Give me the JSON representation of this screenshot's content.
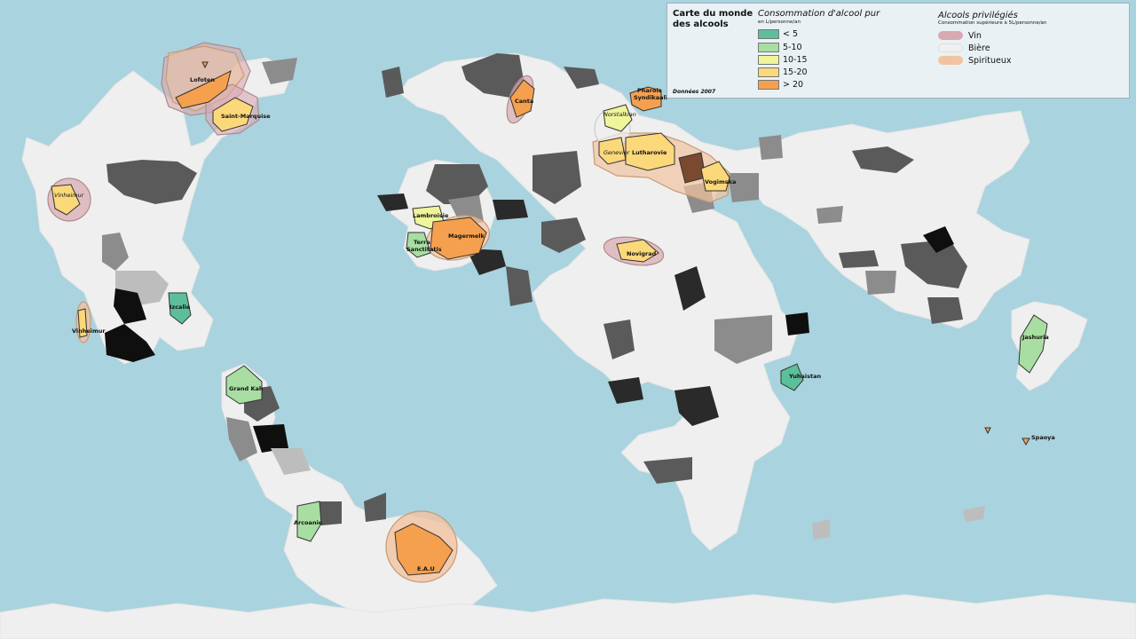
{
  "legend": {
    "title": "Carte du monde des alcools",
    "date": "Données 2007",
    "consumption_title": "Consommation d'alcool pur",
    "consumption_unit": "en L/personne/an",
    "consumption_items": [
      {
        "label": "< 5",
        "color": "#5dbf9a"
      },
      {
        "label": "5-10",
        "color": "#a8dea2"
      },
      {
        "label": "10-15",
        "color": "#eef59a"
      },
      {
        "label": "15-20",
        "color": "#fbd87a"
      },
      {
        "label": "> 20",
        "color": "#f5a04e"
      }
    ],
    "alcohol_title": "Alcools privilégiés",
    "alcohol_sub": "Consommation supérieure à 5L/personne/an",
    "alcohol_items": [
      {
        "label": "Vin",
        "color": "#d9a9b1"
      },
      {
        "label": "Bière",
        "color": "#f0f0f0"
      },
      {
        "label": "Spiritueux",
        "color": "#f1c3a0"
      }
    ]
  },
  "places": {
    "lofoten": "Lofoten",
    "saint_marquise": "Saint-Marquise",
    "canta": "Canta",
    "pharois": "Pharois",
    "syndikaali": "Syndikaali",
    "norstalkian": "Norstalkian",
    "genevier": "Genevier",
    "lutharovie": "Lutharovie",
    "vogimska": "Vogimska",
    "vinheimur_north": "Vinheimur",
    "vinheimur_south": "Vinheimur",
    "lambroisie": "Lambroisie",
    "terra": "Terra",
    "sanctitatis": "Sanctitatis",
    "magermelk": "Magermelk",
    "novigrad": "Novigrad",
    "izcalie": "Izcalie",
    "grand_kah": "Grand Kah",
    "yuhaistan": "Yuhaistan",
    "jashuria": "Jashuria",
    "spaoya": "Spaoya",
    "arcoanie": "Arcoanie",
    "eau": "E.A.U"
  }
}
